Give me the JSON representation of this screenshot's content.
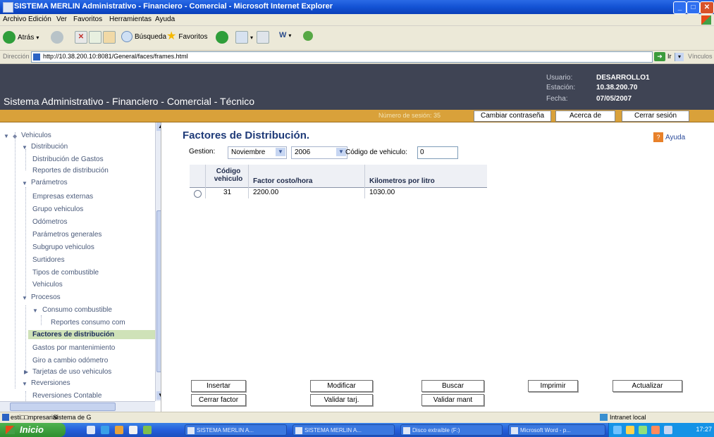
{
  "window": {
    "title": "SISTEMA MERLIN Administrativo - Financiero - Comercial - Microsoft Internet Explorer",
    "min": "_",
    "max": "□",
    "close": "✕"
  },
  "menu": [
    "Archivo",
    "Edición",
    "Ver",
    "Favoritos",
    "Herramientas",
    "Ayuda"
  ],
  "toolbar": {
    "back": "Atrás",
    "search": "Búsqueda",
    "favorites": "Favoritos"
  },
  "address": {
    "label": "Dirección",
    "url": "http://10.38.200.10:8081/General/faces/frames.html",
    "go": "Ir",
    "links": "Vínculos"
  },
  "header": {
    "title": "Sistema Administrativo - Financiero - Comercial - Técnico",
    "user_label": "Usuario:",
    "user": "DESARROLLO1",
    "station_label": "Estación:",
    "station": "10.38.200.70",
    "date_label": "Fecha:",
    "date": "07/05/2007",
    "session": "Número de sesión: 35",
    "change_password": "Cambiar contraseña",
    "about": "Acerca de",
    "logout": "Cerrar sesión"
  },
  "sidebar": {
    "items": [
      {
        "label": "Vehiculos",
        "level": 0,
        "expanded": true
      },
      {
        "label": "Distribución",
        "level": 1,
        "expanded": true
      },
      {
        "label": "Distribución de Gastos",
        "level": 2
      },
      {
        "label": "Reportes de distribución",
        "level": 2
      },
      {
        "label": "Parámetros",
        "level": 1,
        "expanded": true
      },
      {
        "label": "Empresas externas",
        "level": 2
      },
      {
        "label": "Grupo vehiculos",
        "level": 2
      },
      {
        "label": "Odómetros",
        "level": 2
      },
      {
        "label": "Parámetros generales",
        "level": 2
      },
      {
        "label": "Subgrupo vehiculos",
        "level": 2
      },
      {
        "label": "Surtidores",
        "level": 2
      },
      {
        "label": "Tipos de combustible",
        "level": 2
      },
      {
        "label": "Vehiculos",
        "level": 2
      },
      {
        "label": "Procesos",
        "level": 1,
        "expanded": true
      },
      {
        "label": "Consumo combustible",
        "level": 2,
        "expanded": true
      },
      {
        "label": "Reportes consumo com",
        "level": 3
      },
      {
        "label": "Factores de distribución",
        "level": 2,
        "selected": true
      },
      {
        "label": "Gastos por mantenimiento",
        "level": 2
      },
      {
        "label": "Giro a cambio odómetro",
        "level": 2
      },
      {
        "label": "Tarjetas de uso vehiculos",
        "level": 2,
        "collapsed": true
      },
      {
        "label": "Reversiones",
        "level": 1,
        "expanded": true
      },
      {
        "label": "Reversiones Contable",
        "level": 2
      }
    ]
  },
  "main": {
    "title": "Factores de Distribución.",
    "help": "Ayuda",
    "filter": {
      "gestion_label": "Gestion:",
      "month": "Noviembre",
      "year": "2006",
      "vehicle_label": "Código de vehiculo:",
      "vehicle_value": "0"
    },
    "table": {
      "headers": [
        "Código vehiculo",
        "Factor costo/hora",
        "Kilometros por litro"
      ],
      "rows": [
        {
          "code": "31",
          "factor": "2200.00",
          "km": "1030.00"
        }
      ]
    },
    "buttons": {
      "insert": "Insertar",
      "modify": "Modificar",
      "search": "Buscar",
      "print": "Imprimir",
      "refresh": "Actualizar",
      "close_factor": "Cerrar factor",
      "validate_card": "Validar tarj.",
      "validate_maint": "Validar mant"
    }
  },
  "statusbar": {
    "left": "esti□□mpresarial",
    "middle": "Sistema de G",
    "zone": "Intranet local"
  },
  "taskbar": {
    "start": "Inicio",
    "tasks": [
      "SISTEMA MERLIN A...",
      "SISTEMA MERLIN A...",
      "Disco extraíble (F:)",
      "Microsoft Word - p..."
    ],
    "clock": "17:27"
  },
  "colors": {
    "header_bg": "#3f4454",
    "session_bar": "#d9a13a",
    "selected_tree": "#cfe2b8",
    "title_blue": "#1e3a78"
  }
}
